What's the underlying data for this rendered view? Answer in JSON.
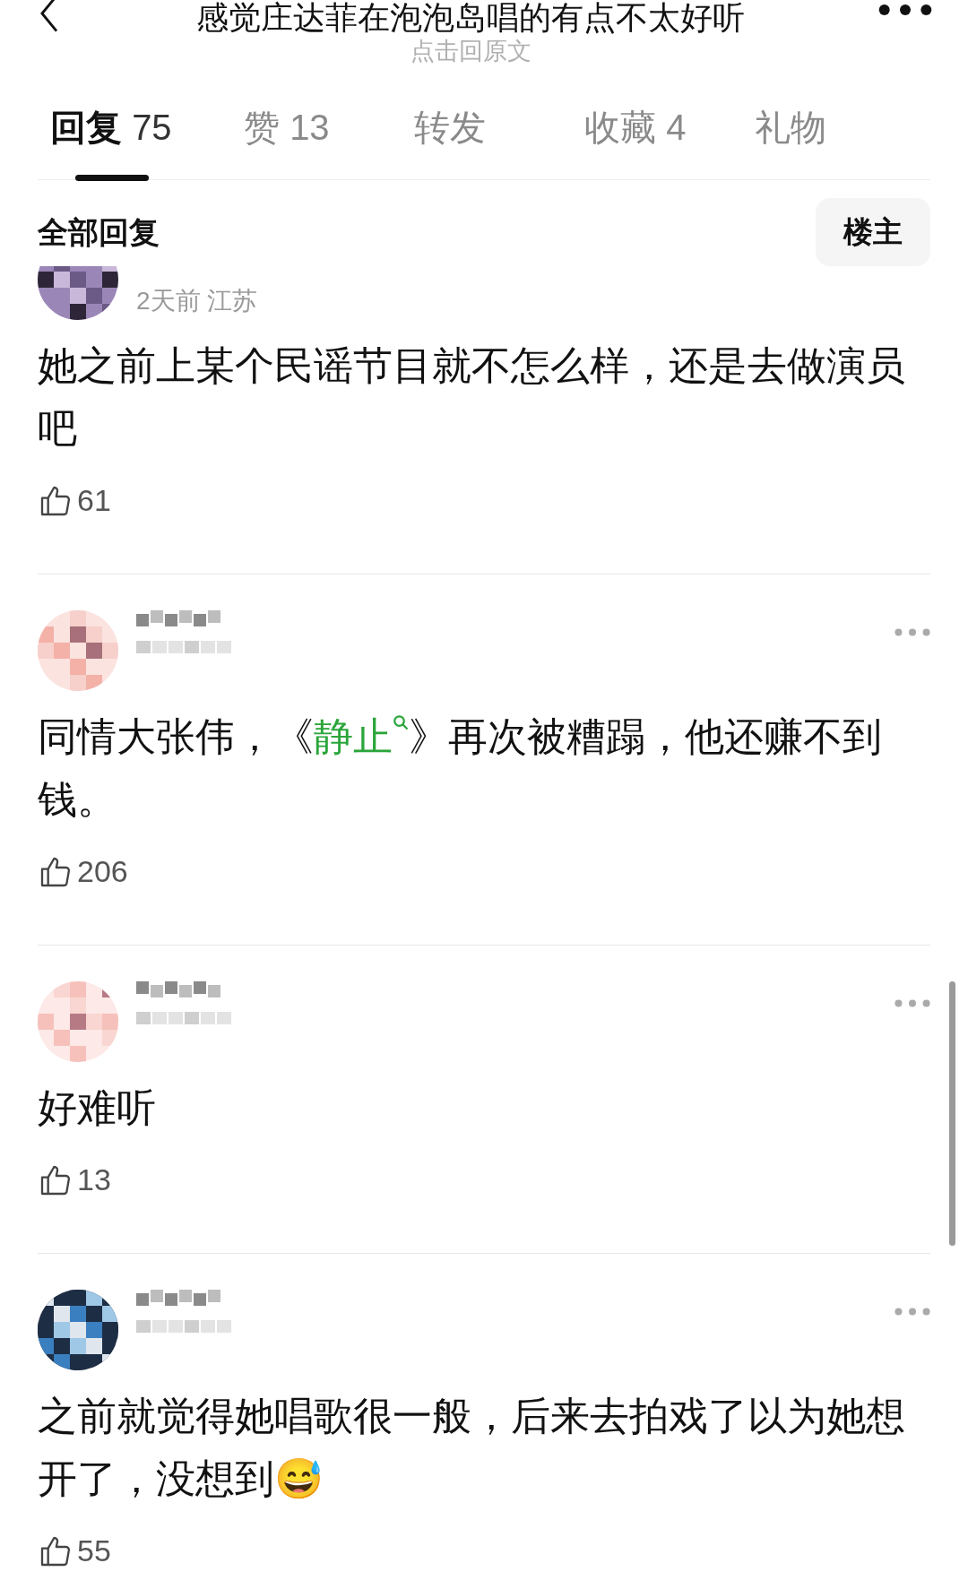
{
  "header": {
    "title": "感觉庄达菲在泡泡岛唱的有点不太好听",
    "subtitle": "点击回原文"
  },
  "tabs": [
    {
      "label": "回复",
      "count": "75",
      "selected": true
    },
    {
      "label": "赞",
      "count": "13",
      "selected": false
    },
    {
      "label": "转发",
      "selected": false
    },
    {
      "label": "收藏",
      "count": "4",
      "selected": false
    },
    {
      "label": "礼物",
      "selected": false
    }
  ],
  "section": {
    "title": "全部回复",
    "filter_button": "楼主"
  },
  "comments": [
    {
      "meta": "2天前 江苏",
      "menu": false,
      "body": [
        {
          "kind": "text",
          "text": "她之前上某个民谣节目就不怎么样，还是去做演员吧"
        }
      ],
      "likes": "61"
    },
    {
      "menu": true,
      "body": [
        {
          "kind": "text",
          "text": "同情大张伟，《"
        },
        {
          "kind": "link",
          "text": "静止"
        },
        {
          "kind": "text",
          "text": "》再次被糟蹋，他还赚不到钱。"
        }
      ],
      "likes": "206"
    },
    {
      "menu": true,
      "body": [
        {
          "kind": "text",
          "text": "好难听"
        }
      ],
      "likes": "13"
    },
    {
      "menu": true,
      "body": [
        {
          "kind": "text",
          "text": "之前就觉得她唱歌很一般，后来去拍戏了以为她想开了，没想到😅"
        }
      ],
      "likes": "55"
    }
  ]
}
